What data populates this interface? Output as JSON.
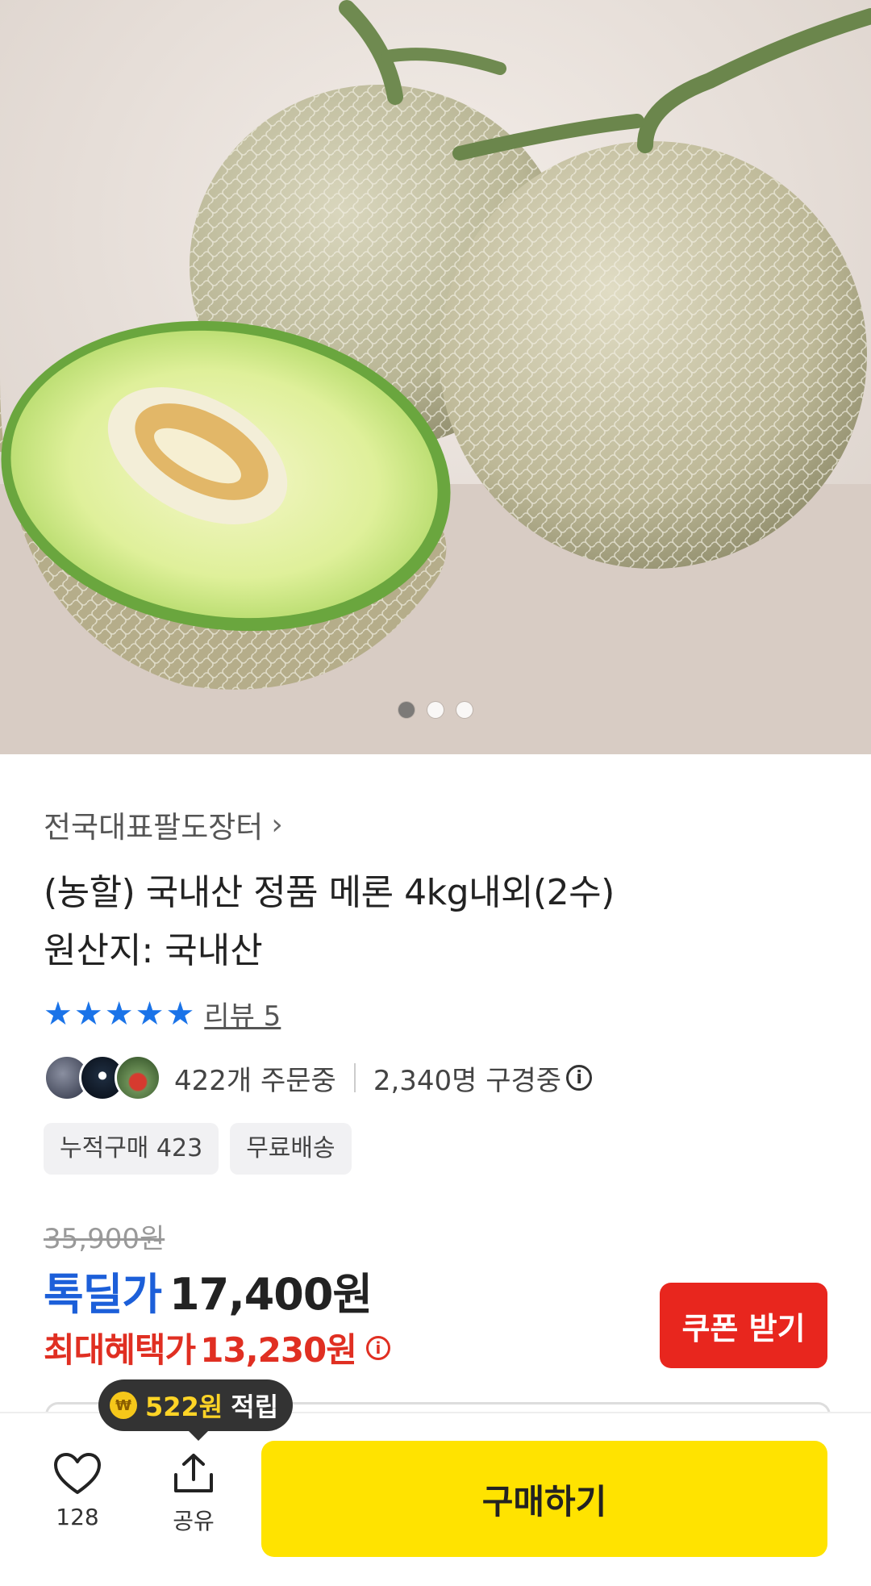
{
  "hero": {
    "image_description": "",
    "carousel": {
      "total": 3,
      "active": 1
    }
  },
  "product": {
    "store_name": "전국대표팔도장터",
    "title": "(농할) 국내산 정품 메론 4kg내외(2수)",
    "origin": "원산지: 국내산",
    "rating_stars": 5,
    "review_link": "리뷰 5",
    "orders_text": "422개 주문중",
    "viewers_text": "2,340명 구경중",
    "tags": [
      "누적구매 423",
      "무료배송"
    ]
  },
  "pricing": {
    "original_price": "35,900원",
    "deal_label": "톡딜가",
    "deal_price": "17,400원",
    "max_benefit_label": "최대혜택가",
    "max_benefit_price": "13,230원",
    "coupon_button": "쿠폰 받기"
  },
  "reward_tooltip": {
    "amount": "522원",
    "word": "적립"
  },
  "bottom_bar": {
    "like_count": "128",
    "share_label": "공유",
    "buy_button": "구매하기"
  },
  "colors": {
    "deal_blue": "#1c5fd9",
    "benefit_red": "#e02f22",
    "coupon_red": "#e8261e",
    "buy_yellow": "#ffe300",
    "star_blue": "#1a73e8"
  }
}
